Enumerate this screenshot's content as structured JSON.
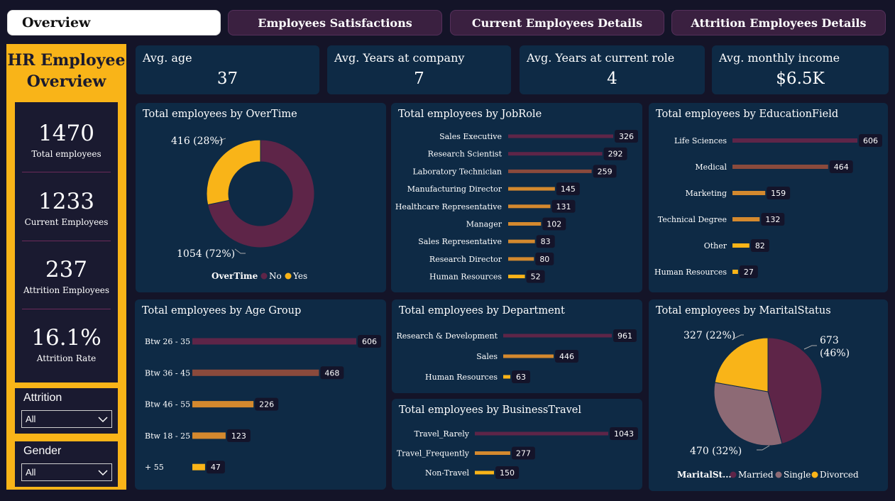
{
  "tabs": [
    "Overview",
    "Employees Satisfactions",
    "Current Employees Details",
    "Attrition Employees Details"
  ],
  "sidebar": {
    "title_line1": "HR Employee",
    "title_line2": "Overview",
    "kpis": [
      {
        "value": "1470",
        "label": "Total employees"
      },
      {
        "value": "1233",
        "label": "Current Employees"
      },
      {
        "value": "237",
        "label": "Attrition Employees"
      },
      {
        "value": "16.1%",
        "label": "Attrition Rate"
      }
    ],
    "slicers": [
      {
        "title": "Attrition",
        "value": "All"
      },
      {
        "title": "Gender",
        "value": "All"
      }
    ]
  },
  "cards": [
    {
      "title": "Avg. age",
      "value": "37"
    },
    {
      "title": "Avg. Years at company",
      "value": "7"
    },
    {
      "title": "Avg. Years at current role",
      "value": "4"
    },
    {
      "title": "Avg. monthly income",
      "value": "$6.5K"
    }
  ],
  "colors": {
    "maroon": "#5e2548",
    "brown": "#8a4a3c",
    "orange": "#d4892e",
    "yellow": "#f9b418",
    "mauve": "#8d6a75"
  },
  "chart_data": [
    {
      "id": "overtime",
      "type": "pie",
      "donut": true,
      "title": "Total employees by OverTime",
      "legend_title": "OverTime",
      "slices": [
        {
          "name": "No",
          "value": 1054,
          "label": "1054 (72%)",
          "color": "#5e2548"
        },
        {
          "name": "Yes",
          "value": 416,
          "label": "416 (28%)",
          "color": "#f9b418"
        }
      ]
    },
    {
      "id": "jobrole",
      "type": "bar",
      "orientation": "horizontal",
      "title": "Total employees by JobRole",
      "categories": [
        "Sales Executive",
        "Research Scientist",
        "Laboratory Technician",
        "Manufacturing Director",
        "Healthcare Representative",
        "Manager",
        "Sales Representative",
        "Research Director",
        "Human Resources"
      ],
      "values": [
        326,
        292,
        259,
        145,
        131,
        102,
        83,
        80,
        52
      ]
    },
    {
      "id": "education",
      "type": "bar",
      "orientation": "horizontal",
      "title": "Total employees by EducationField",
      "categories": [
        "Life Sciences",
        "Medical",
        "Marketing",
        "Technical Degree",
        "Other",
        "Human Resources"
      ],
      "values": [
        606,
        464,
        159,
        132,
        82,
        27
      ]
    },
    {
      "id": "agegroup",
      "type": "bar",
      "orientation": "horizontal",
      "title": "Total employees by Age Group",
      "categories": [
        "Btw 26 - 35",
        "Btw 36 - 45",
        "Btw 46 - 55",
        "Btw 18 - 25",
        "+ 55"
      ],
      "values": [
        606,
        468,
        226,
        123,
        47
      ]
    },
    {
      "id": "department",
      "type": "bar",
      "orientation": "horizontal",
      "title": "Total employees by Department",
      "categories": [
        "Research & Development",
        "Sales",
        "Human Resources"
      ],
      "values": [
        961,
        446,
        63
      ]
    },
    {
      "id": "travel",
      "type": "bar",
      "orientation": "horizontal",
      "title": "Total employees by BusinessTravel",
      "categories": [
        "Travel_Rarely",
        "Travel_Frequently",
        "Non-Travel"
      ],
      "values": [
        1043,
        277,
        150
      ]
    },
    {
      "id": "marital",
      "type": "pie",
      "title": "Total employees by MaritalStatus",
      "legend_title": "MaritalSt...",
      "slices": [
        {
          "name": "Married",
          "value": 673,
          "label_l1": "673",
          "label_l2": "(46%)",
          "color": "#5e2548"
        },
        {
          "name": "Single",
          "value": 470,
          "label": "470 (32%)",
          "color": "#8d6a75"
        },
        {
          "name": "Divorced",
          "value": 327,
          "label": "327 (22%)",
          "color": "#f9b418"
        }
      ]
    }
  ]
}
